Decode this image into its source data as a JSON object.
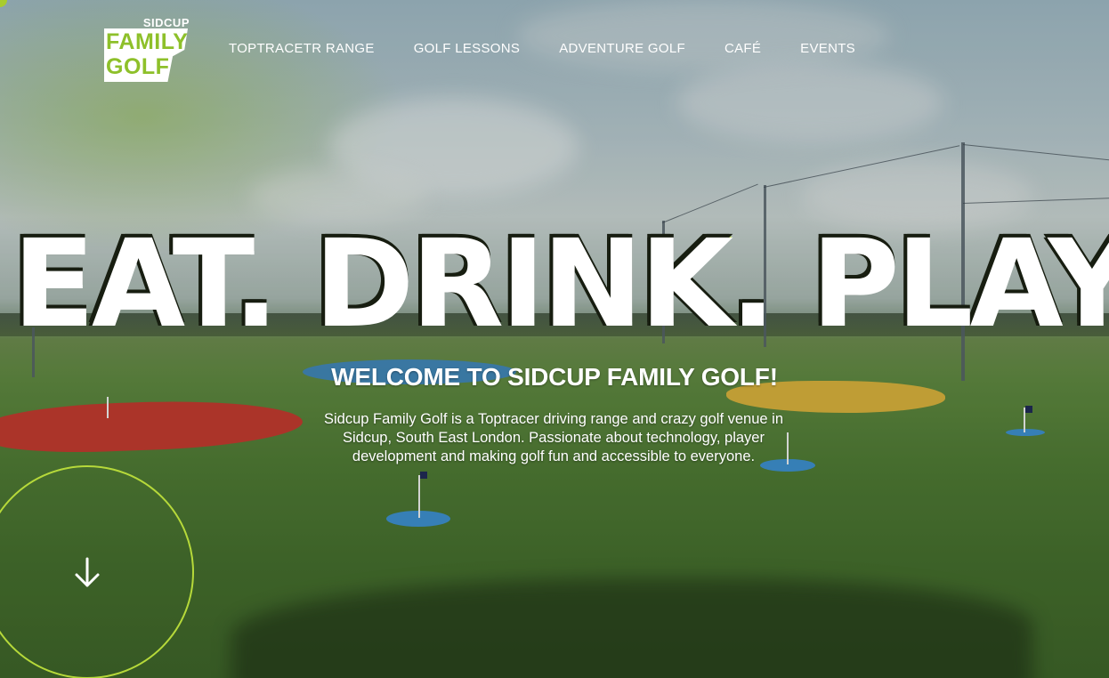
{
  "brand": {
    "logo_top": "SIDCUP",
    "logo_line1": "FAMILY",
    "logo_line2": "GOLF",
    "accent_color": "#a9cc2d"
  },
  "nav": {
    "items": [
      {
        "label": "TOPTRACETR RANGE"
      },
      {
        "label": "GOLF LESSONS"
      },
      {
        "label": "ADVENTURE GOLF"
      },
      {
        "label": "CAFÉ"
      },
      {
        "label": "EVENTS"
      }
    ]
  },
  "hero": {
    "headline": "EAT. DRINK. PLAY.",
    "welcome": "WELCOME TO SIDCUP FAMILY GOLF!",
    "intro": "Sidcup Family Golf is a Toptracer driving range and crazy golf venue in Sidcup, South East London. Passionate about technology, player development and making golf fun and accessible to everyone.",
    "scroll_icon": "arrow-down-icon"
  }
}
